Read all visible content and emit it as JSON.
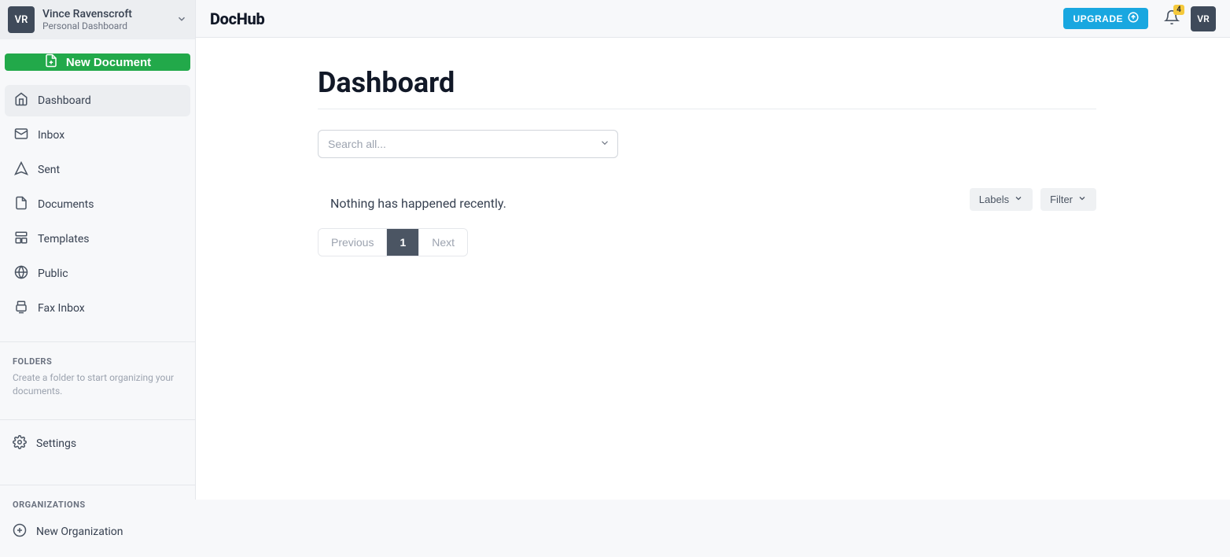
{
  "user": {
    "initials": "VR",
    "name": "Vince Ravenscroft",
    "subtitle": "Personal Dashboard"
  },
  "brand": "DocHub",
  "sidebar": {
    "new_document_label": "New Document",
    "items": [
      {
        "id": "dashboard",
        "label": "Dashboard"
      },
      {
        "id": "inbox",
        "label": "Inbox"
      },
      {
        "id": "sent",
        "label": "Sent"
      },
      {
        "id": "documents",
        "label": "Documents"
      },
      {
        "id": "templates",
        "label": "Templates"
      },
      {
        "id": "public",
        "label": "Public"
      },
      {
        "id": "fax-inbox",
        "label": "Fax Inbox"
      }
    ],
    "folders_title": "FOLDERS",
    "folders_hint": "Create a folder to start organizing your documents.",
    "settings_label": "Settings",
    "orgs_title": "ORGANIZATIONS",
    "new_org_label": "New Organization"
  },
  "topbar": {
    "upgrade_label": "UPGRADE",
    "notification_count": "4"
  },
  "main": {
    "title": "Dashboard",
    "search_placeholder": "Search all...",
    "labels_btn": "Labels",
    "filter_btn": "Filter",
    "empty_message": "Nothing has happened recently.",
    "pagination": {
      "previous": "Previous",
      "page": "1",
      "next": "Next"
    }
  }
}
